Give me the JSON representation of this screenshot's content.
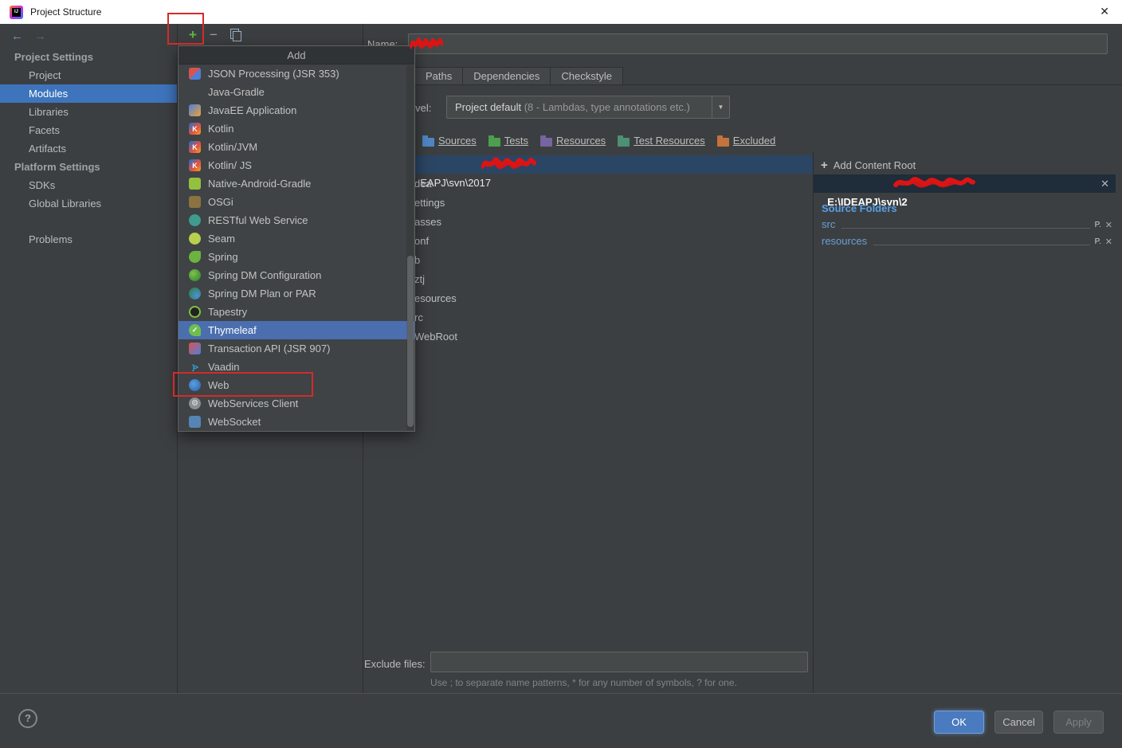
{
  "colors": {
    "selection_blue": "#4b6eaf",
    "sidebar_selection": "#3e74bc",
    "tree_selection": "#2b4564",
    "annotation_red": "#d42a2a",
    "link_blue": "#6a9fd8",
    "source_folders_blue": "#56a0e8",
    "ok_button_blue": "#4a7bc0",
    "add_plus_green": "#62b543",
    "background_dark": "#3c3f41"
  },
  "window": {
    "title": "Project Structure",
    "close_glyph": "✕"
  },
  "nav": {
    "back_glyph": "←",
    "forward_glyph": "→"
  },
  "toolbar": {
    "add_glyph": "+",
    "remove_glyph": "−",
    "copy_icon": "copy"
  },
  "sidebar": {
    "rows": [
      {
        "label": "Project Settings",
        "cls": "header"
      },
      {
        "label": "Project",
        "cls": ""
      },
      {
        "label": "Modules",
        "cls": "selected"
      },
      {
        "label": "Libraries",
        "cls": ""
      },
      {
        "label": "Facets",
        "cls": ""
      },
      {
        "label": "Artifacts",
        "cls": ""
      },
      {
        "label": "Platform Settings",
        "cls": "header"
      },
      {
        "label": "SDKs",
        "cls": ""
      },
      {
        "label": "Global Libraries",
        "cls": ""
      },
      {
        "label": "Problems",
        "cls": "problems"
      }
    ]
  },
  "popup": {
    "title": "Add",
    "items": [
      {
        "label": "JSON Processing (JSR 353)",
        "icon_cls": "icon-json",
        "cls": ""
      },
      {
        "label": "Java-Gradle",
        "icon_cls": "icon-none",
        "cls": ""
      },
      {
        "label": "JavaEE Application",
        "icon_cls": "icon-javaee",
        "cls": ""
      },
      {
        "label": "Kotlin",
        "icon_cls": "icon-kotlin",
        "cls": ""
      },
      {
        "label": "Kotlin/JVM",
        "icon_cls": "icon-kotlin",
        "cls": ""
      },
      {
        "label": "Kotlin/ JS",
        "icon_cls": "icon-kotlin",
        "cls": ""
      },
      {
        "label": "Native-Android-Gradle",
        "icon_cls": "icon-android",
        "cls": ""
      },
      {
        "label": "OSGi",
        "icon_cls": "icon-osgi",
        "cls": ""
      },
      {
        "label": "RESTful Web Service",
        "icon_cls": "icon-rest",
        "cls": ""
      },
      {
        "label": "Seam",
        "icon_cls": "icon-seam",
        "cls": ""
      },
      {
        "label": "Spring",
        "icon_cls": "icon-spring",
        "cls": ""
      },
      {
        "label": "Spring DM Configuration",
        "icon_cls": "icon-springdm",
        "cls": ""
      },
      {
        "label": "Spring DM Plan or PAR",
        "icon_cls": "icon-springdm2",
        "cls": ""
      },
      {
        "label": "Tapestry",
        "icon_cls": "icon-tapestry",
        "cls": ""
      },
      {
        "label": "Thymeleaf",
        "icon_cls": "icon-thymeleaf",
        "cls": "selected"
      },
      {
        "label": "Transaction API (JSR 907)",
        "icon_cls": "icon-transaction",
        "cls": ""
      },
      {
        "label": "Vaadin",
        "icon_cls": "icon-vaadin",
        "cls": ""
      },
      {
        "label": "Web",
        "icon_cls": "icon-web",
        "cls": ""
      },
      {
        "label": "WebServices Client",
        "icon_cls": "icon-webservices",
        "cls": ""
      },
      {
        "label": "WebSocket",
        "icon_cls": "icon-websocket",
        "cls": ""
      }
    ]
  },
  "editor": {
    "name_label": "Name:",
    "tabs": [
      {
        "label": "Paths"
      },
      {
        "label": "Dependencies"
      },
      {
        "label": "Checkstyle"
      }
    ],
    "language_level_label": "level:",
    "language_level_value": "Project default",
    "language_level_detail": " (8 - Lambdas, type annotations etc.)",
    "combo_arrow_glyph": "▼",
    "mark_as": [
      {
        "label": "Sources",
        "icon": "folder-sources"
      },
      {
        "label": "Tests",
        "icon": "folder-tests"
      },
      {
        "label": "Resources",
        "icon": "folder-resources"
      },
      {
        "label": "Test Resources",
        "icon": "folder-test-resources"
      },
      {
        "label": "Excluded",
        "icon": "folder-excluded"
      }
    ],
    "exclude_label": "Exclude files:",
    "exclude_value": "",
    "exclude_hint": "Use ; to separate name patterns, * for any number of symbols, ? for one."
  },
  "tree": {
    "root_visible_text": "EAPJ\\svn\\2017",
    "rows": [
      "dea",
      "ettings",
      "asses",
      "onf",
      "b",
      "ztj",
      "esources",
      "rc",
      "WebRoot"
    ]
  },
  "content_root": {
    "add_glyph": "+",
    "add_label": "Add Content Root",
    "path_visible": "E:\\IDEAPJ\\svn\\2",
    "close_glyph": "✕",
    "source_folders_header": "Source Folders",
    "folders": [
      {
        "name": "src",
        "badge": "P."
      },
      {
        "name": "resources",
        "badge": "P."
      }
    ]
  },
  "footer": {
    "help_glyph": "?",
    "ok": "OK",
    "cancel": "Cancel",
    "apply": "Apply"
  }
}
